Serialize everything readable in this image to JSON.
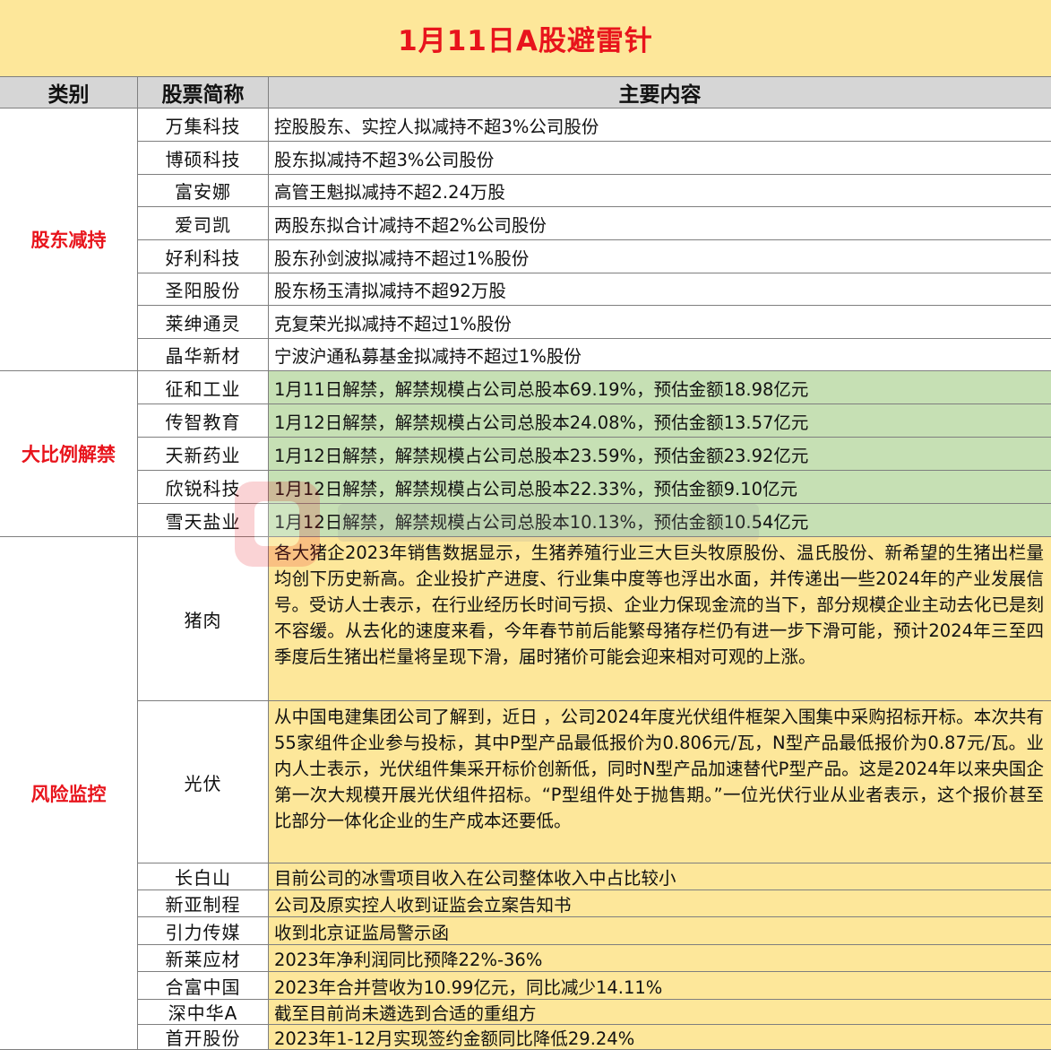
{
  "title": "1月11日A股避雷针",
  "headers": {
    "category": "类别",
    "stock": "股票简称",
    "content": "主要内容"
  },
  "categories": [
    "股东减持",
    "大比例解禁",
    "风险监控"
  ],
  "rows": [
    {
      "name": "万集科技",
      "content": "控股股东、实控人拟减持不超3%公司股份"
    },
    {
      "name": "博硕科技",
      "content": "股东拟减持不超3%公司股份"
    },
    {
      "name": "富安娜",
      "content": "高管王魁拟减持不超2.24万股"
    },
    {
      "name": "爱司凯",
      "content": "两股东拟合计减持不超2%公司股份"
    },
    {
      "name": "好利科技",
      "content": "股东孙剑波拟减持不超过1%股份"
    },
    {
      "name": "圣阳股份",
      "content": "股东杨玉清拟减持不超92万股"
    },
    {
      "name": "莱绅通灵",
      "content": "克复荣光拟减持不超过1%股份"
    },
    {
      "name": "晶华新材",
      "content": "宁波沪通私募基金拟减持不超过1%股份"
    },
    {
      "name": "征和工业",
      "content": "1月11日解禁，解禁规模占公司总股本69.19%，预估金额18.98亿元"
    },
    {
      "name": "传智教育",
      "content": "1月12日解禁，解禁规模占公司总股本24.08%，预估金额13.57亿元"
    },
    {
      "name": "天新药业",
      "content": "1月12日解禁，解禁规模占公司总股本23.59%，预估金额23.92亿元"
    },
    {
      "name": "欣锐科技",
      "content": "1月12日解禁，解禁规模占公司总股本22.33%，预估金额9.10亿元"
    },
    {
      "name": "雪天盐业",
      "content": "1月12日解禁，解禁规模占公司总股本10.13%，预估金额10.54亿元"
    },
    {
      "name": "猪肉",
      "content": "各大猪企2023年销售数据显示，生猪养殖行业三大巨头牧原股份、温氏股份、新希望的生猪出栏量均创下历史新高。企业投扩产进度、行业集中度等也浮出水面，并传递出一些2024年的产业发展信号。受访人士表示，在行业经历长时间亏损、企业力保现金流的当下，部分规模企业主动去化已是刻不容缓。从去化的速度来看，今年春节前后能繁母猪存栏仍有进一步下滑可能，预计2024年三至四季度后生猪出栏量将呈现下滑，届时猪价可能会迎来相对可观的上涨。"
    },
    {
      "name": "光伏",
      "content": "从中国电建集团公司了解到，近日 ，公司2024年度光伏组件框架入围集中采购招标开标。本次共有55家组件企业参与投标，其中P型产品最低报价为0.806元/瓦，N型产品最低报价为0.87元/瓦。业内人士表示，光伏组件集采开标价创新低，同时N型产品加速替代P型产品。这是2024年以来央国企第一次大规模开展光伏组件招标。“P型组件处于抛售期。”一位光伏行业从业者表示，这个报价甚至比部分一体化企业的生产成本还要低。"
    },
    {
      "name": "长白山",
      "content": "目前公司的冰雪项目收入在公司整体收入中占比较小"
    },
    {
      "name": "新亚制程",
      "content": "公司及原实控人收到证监会立案告知书"
    },
    {
      "name": "引力传媒",
      "content": "收到北京证监局警示函"
    },
    {
      "name": "新莱应材",
      "content": "2023年净利润同比预降22%-36%"
    },
    {
      "name": "合富中国",
      "content": "2023年合并营收为10.99亿元，同比减少14.11%"
    },
    {
      "name": "深中华A",
      "content": "截至目前尚未遴选到合适的重组方"
    },
    {
      "name": "首开股份",
      "content": "2023年1-12月实现签约金额同比降低29.24%"
    }
  ],
  "colors": {
    "title_red": "#e8141c",
    "header_gray": "#d6d6d6",
    "unlock_green": "#c6e0b4",
    "risk_yellow": "#fde79a"
  }
}
